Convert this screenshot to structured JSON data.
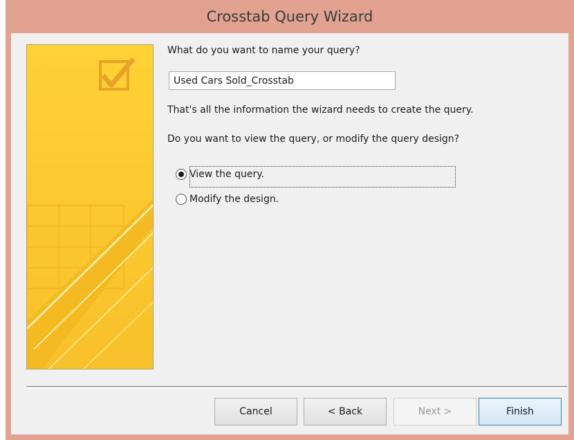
{
  "window": {
    "title": "Crosstab Query Wizard"
  },
  "form": {
    "name_prompt": "What do you want to name your query?",
    "query_name_value": "Used Cars Sold_Crosstab",
    "info_text": "That's all the information the wizard needs to create the query.",
    "choice_prompt": "Do you want to view the query, or modify the query design?",
    "options": [
      {
        "label": "View the query.",
        "selected": true
      },
      {
        "label": "Modify the design.",
        "selected": false
      }
    ]
  },
  "buttons": {
    "cancel": "Cancel",
    "back": "< Back",
    "next": "Next >",
    "finish": "Finish"
  },
  "colors": {
    "titlebar": "#e2a292",
    "panel": "#f0f0f0",
    "wizard_art": "#fcc92e"
  }
}
